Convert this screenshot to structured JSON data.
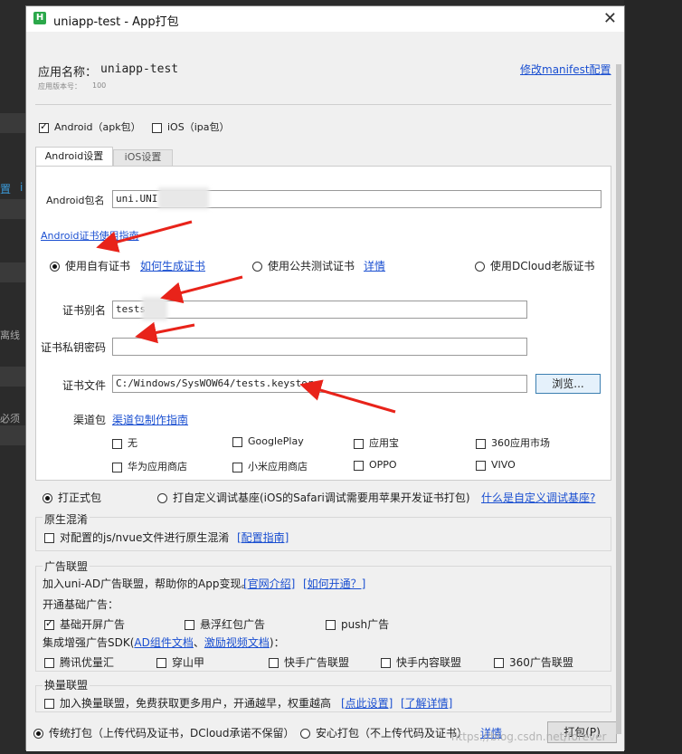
{
  "background": {
    "link1": "置",
    "link2": "i",
    "text1": "离线",
    "text2": "必须"
  },
  "window": {
    "icon_letter": "H",
    "title": "uniapp-test - App打包",
    "close_glyph": "✕"
  },
  "app": {
    "name_label": "应用名称：",
    "name": "uniapp-test",
    "version_label": "应用版本号：",
    "version": "100",
    "manifest_link": "修改manifest配置"
  },
  "platforms": {
    "android": {
      "label": "Android（apk包）",
      "checked": true
    },
    "ios": {
      "label": "iOS（ipa包）",
      "checked": false
    }
  },
  "tabs": [
    {
      "label": "Android设置",
      "active": true
    },
    {
      "label": "iOS设置",
      "active": false
    }
  ],
  "android": {
    "package_label": "Android包名",
    "package_value": "uni.UNI",
    "cert_guide_link": "Android证书使用指南",
    "cert_options": [
      {
        "label": "使用自有证书",
        "selected": true
      },
      {
        "label": "使用公共测试证书",
        "selected": false
      },
      {
        "label": "使用DCloud老版证书",
        "selected": false
      }
    ],
    "how_to_generate_link": "如何生成证书",
    "details_link": "详情",
    "alias_label": "证书别名",
    "alias_value": "tests",
    "password_label": "证书私钥密码",
    "password_value": "",
    "file_label": "证书文件",
    "file_value": "C:/Windows/SysWOW64/tests.keystore",
    "browse_button": "浏览...",
    "channel_label": "渠道包",
    "channel_guide_link": "渠道包制作指南",
    "channels": [
      {
        "label": "无",
        "checked": false
      },
      {
        "label": "GooglePlay",
        "checked": false
      },
      {
        "label": "应用宝",
        "checked": false
      },
      {
        "label": "360应用市场",
        "checked": false
      },
      {
        "label": "华为应用商店",
        "checked": false
      },
      {
        "label": "小米应用商店",
        "checked": false
      },
      {
        "label": "OPPO",
        "checked": false
      },
      {
        "label": "VIVO",
        "checked": false
      }
    ]
  },
  "build_type": {
    "release": {
      "label": "打正式包",
      "selected": true
    },
    "custom_base": {
      "label": "打自定义调试基座(iOS的Safari调试需要用苹果开发证书打包)",
      "selected": false
    },
    "what_is_link": "什么是自定义调试基座?"
  },
  "obfuscation": {
    "title": "原生混淆",
    "option": {
      "label": "对配置的js/nvue文件进行原生混淆",
      "checked": false
    },
    "guide_link": "[配置指南]"
  },
  "ads": {
    "title": "广告联盟",
    "intro": "加入uni-AD广告联盟，帮助你的App变现。",
    "official_link": "[官网介绍]",
    "how_link": "[如何开通？]",
    "basic_label": "开通基础广告：",
    "basic": [
      {
        "label": "基础开屏广告",
        "checked": true
      },
      {
        "label": "悬浮红包广告",
        "checked": false
      },
      {
        "label": "push广告",
        "checked": false
      }
    ],
    "sdk_prefix": "集成增强广告SDK(",
    "ad_docs_link": "AD组件文档",
    "sdk_sep": "、",
    "video_docs_link": "激励视频文档",
    "sdk_suffix": ")：",
    "sdk": [
      {
        "label": "腾讯优量汇",
        "checked": false
      },
      {
        "label": "穿山甲",
        "checked": false
      },
      {
        "label": "快手广告联盟",
        "checked": false
      },
      {
        "label": "快手内容联盟",
        "checked": false
      },
      {
        "label": "360广告联盟",
        "checked": false
      }
    ]
  },
  "exchange": {
    "title": "换量联盟",
    "option": {
      "label": "加入换量联盟，免费获取更多用户，开通越早，权重越高",
      "checked": false
    },
    "settings_link": "[点此设置]",
    "details_link": "[了解详情]"
  },
  "footer": {
    "traditional": {
      "label": "传统打包（上传代码及证书，DCloud承诺不保留）",
      "selected": true
    },
    "safe": {
      "label": "安心打包（不上传代码及证书）",
      "selected": false
    },
    "details_link": "详情",
    "pack_button": "打包(P)"
  },
  "watermark": "https://blog.csdn.net/forever",
  "colors": {
    "link": "#1a4fd1",
    "arrow": "#e8231a",
    "window_bg": "#f0f0f0"
  }
}
